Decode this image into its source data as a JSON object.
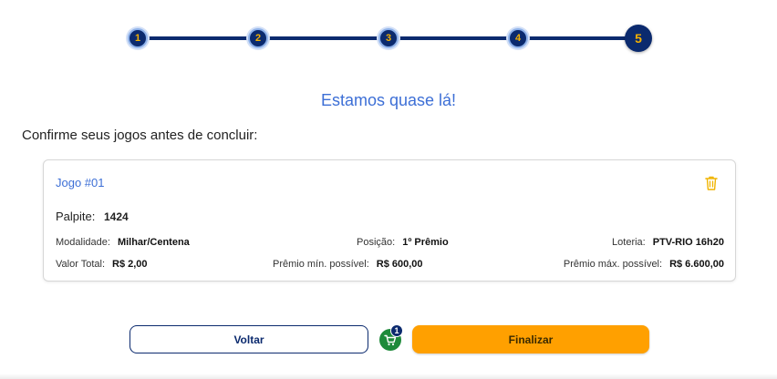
{
  "stepper": {
    "steps": [
      "1",
      "2",
      "3",
      "4",
      "5"
    ],
    "current": 5
  },
  "headline": "Estamos quase lá!",
  "subheading": "Confirme seus jogos antes de concluir:",
  "game": {
    "title": "Jogo #01",
    "palpite_label": "Palpite:",
    "palpite_value": "1424",
    "modalidade_label": "Modalidade:",
    "modalidade_value": "Milhar/Centena",
    "posicao_label": "Posição:",
    "posicao_value": "1º Prêmio",
    "loteria_label": "Loteria:",
    "loteria_value": "PTV-RIO 16h20",
    "valor_total_label": "Valor Total:",
    "valor_total_value": "R$ 2,00",
    "premio_min_label": "Prêmio mín. possível:",
    "premio_min_value": "R$ 600,00",
    "premio_max_label": "Prêmio máx. possível:",
    "premio_max_value": "R$ 6.600,00",
    "delete_icon": "trash-icon"
  },
  "actions": {
    "back_label": "Voltar",
    "finish_label": "Finalizar",
    "cart_count": "1",
    "cart_icon": "cart-icon"
  },
  "colors": {
    "primary": "#0b2a6e",
    "accent": "#ffa000",
    "link": "#3d6fd6",
    "cart": "#1e8a3a"
  }
}
